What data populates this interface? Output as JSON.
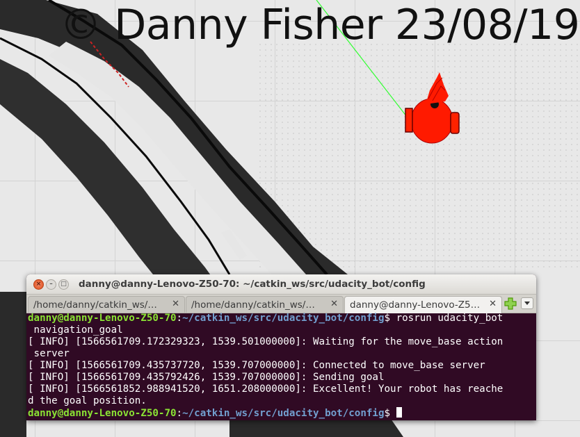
{
  "watermark": "© Danny Fisher 23/08/19",
  "terminal": {
    "window_title": "danny@danny-Lenovo-Z50-70: ~/catkin_ws/src/udacity_bot/config",
    "tabs": [
      {
        "label": "/home/danny/catkin_ws/…",
        "active": false
      },
      {
        "label": "/home/danny/catkin_ws/…",
        "active": false
      },
      {
        "label": "danny@danny-Lenovo-Z5…",
        "active": true
      }
    ],
    "prompt_user": "danny@danny-Lenovo-Z50-70",
    "prompt_path": "~/catkin_ws/src/udacity_bot/config",
    "prompt_symbol": "$",
    "command_line_1": " rosrun udacity_bot",
    "command_line_2": " navigation_goal",
    "output": [
      "[ INFO] [1566561709.172329323, 1539.501000000]: Waiting for the move_base action",
      " server",
      "[ INFO] [1566561709.435737720, 1539.707000000]: Connected to move_base server",
      "[ INFO] [1566561709.435792426, 1539.707000000]: Sending goal",
      "[ INFO] [1566561852.988941520, 1651.208000000]: Excellent! Your robot has reache",
      "d the goal position."
    ]
  },
  "colors": {
    "terminal_bg": "#300a24",
    "prompt_user": "#8ae234",
    "prompt_path": "#729fcf",
    "robot": "#ff0000",
    "path_line": "#33ff33",
    "map_obstacle": "#2b2b2b"
  },
  "icons": [
    "close-icon",
    "minimize-icon",
    "maximize-icon",
    "tab-close-icon",
    "add-tab-icon",
    "chevron-down-icon"
  ]
}
